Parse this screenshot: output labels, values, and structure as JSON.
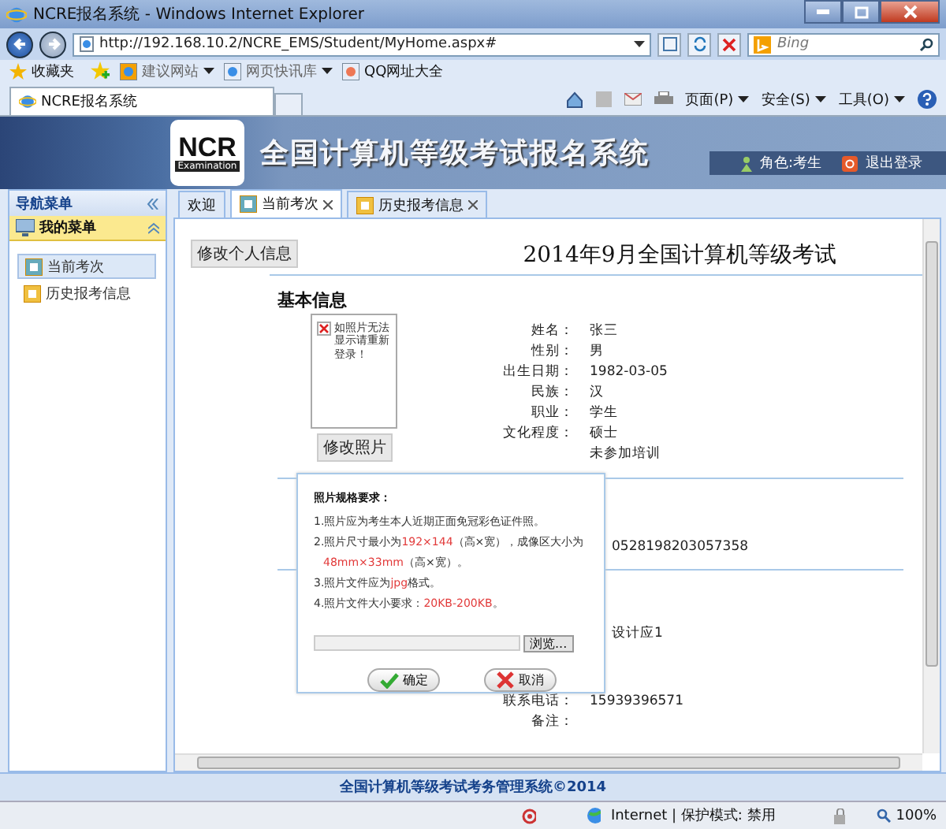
{
  "window": {
    "title": "NCRE报名系统 - Windows Internet Explorer"
  },
  "address_bar": {
    "url": "http://192.168.10.2/NCRE_EMS/Student/MyHome.aspx#",
    "search_placeholder": "Bing"
  },
  "favorites_bar": {
    "favorites": "收藏夹",
    "links": [
      {
        "label": "建议网站",
        "dropdown": true
      },
      {
        "label": "网页快讯库",
        "dropdown": true
      },
      {
        "label": "QQ网址大全",
        "dropdown": false
      }
    ]
  },
  "browser_tabs": [
    {
      "label": "NCRE报名系统",
      "selected": true
    }
  ],
  "command_bar": [
    "页面(P)",
    "安全(S)",
    "工具(O)"
  ],
  "banner": {
    "logo_text": "NCR",
    "logo_subtext": "Examination",
    "title": "全国计算机等级考试报名系统",
    "role": "角色:考生",
    "logout": "退出登录"
  },
  "sidebar": {
    "title": "导航菜单",
    "group": "我的菜单",
    "items": [
      {
        "label": "当前考次",
        "selected": true
      },
      {
        "label": "历史报考信息",
        "selected": false
      }
    ]
  },
  "tabs": [
    {
      "label": "欢迎",
      "selected": false,
      "closable": false
    },
    {
      "label": "当前考次",
      "selected": true,
      "closable": true
    },
    {
      "label": "历史报考信息",
      "selected": false,
      "closable": true
    }
  ],
  "page": {
    "edit_button": "修改个人信息",
    "title": "2014年9月全国计算机等级考试",
    "section": "基本信息",
    "photo_message": "如照片无法显示请重新登录！",
    "photo_button": "修改照片",
    "basic_rows": [
      {
        "label": "姓名：",
        "value": "张三"
      },
      {
        "label": "性别：",
        "value": "男"
      },
      {
        "label": "出生日期：",
        "value": "1982-03-05"
      },
      {
        "label": "民族：",
        "value": "汉"
      },
      {
        "label": "职业：",
        "value": "学生"
      },
      {
        "label": "文化程度：",
        "value": "硕士"
      },
      {
        "value": "未参加培训"
      }
    ],
    "id_rows": [
      {
        "value": "0528198203057358"
      }
    ],
    "contact_rows": [
      {
        "value": "设计应1"
      },
      {
        "label": "联系电话：",
        "value": "15939396571"
      },
      {
        "label": "备注："
      }
    ]
  },
  "dialog": {
    "title": "照片规格要求：",
    "lines": [
      [
        {
          "text": "1.照片应为考生本人近期正面免冠彩色证件照。",
          "highlight": false
        }
      ],
      [
        {
          "text": "2.照片尺寸最小为",
          "highlight": false
        },
        {
          "text": "192×144",
          "highlight": true
        },
        {
          "text": "（高×宽），成像区大小为",
          "highlight": false
        }
      ],
      [
        {
          "text": "48mm×33mm",
          "highlight": true
        },
        {
          "text": "（高×宽）。",
          "highlight": false
        }
      ],
      [
        {
          "text": "3.照片文件应为",
          "highlight": false
        },
        {
          "text": "jpg",
          "highlight": true
        },
        {
          "text": "格式。",
          "highlight": false
        }
      ],
      [
        {
          "text": "4.照片文件大小要求：",
          "highlight": false
        },
        {
          "text": "20KB-200KB",
          "highlight": true
        },
        {
          "text": "。",
          "highlight": false
        }
      ]
    ],
    "browse": "浏览...",
    "ok": "确定",
    "cancel": "取消"
  },
  "footer": "全国计算机等级考试考务管理系统©2014",
  "status_bar": {
    "zone": "Internet | 保护模式: 禁用",
    "zoom": "100%"
  }
}
